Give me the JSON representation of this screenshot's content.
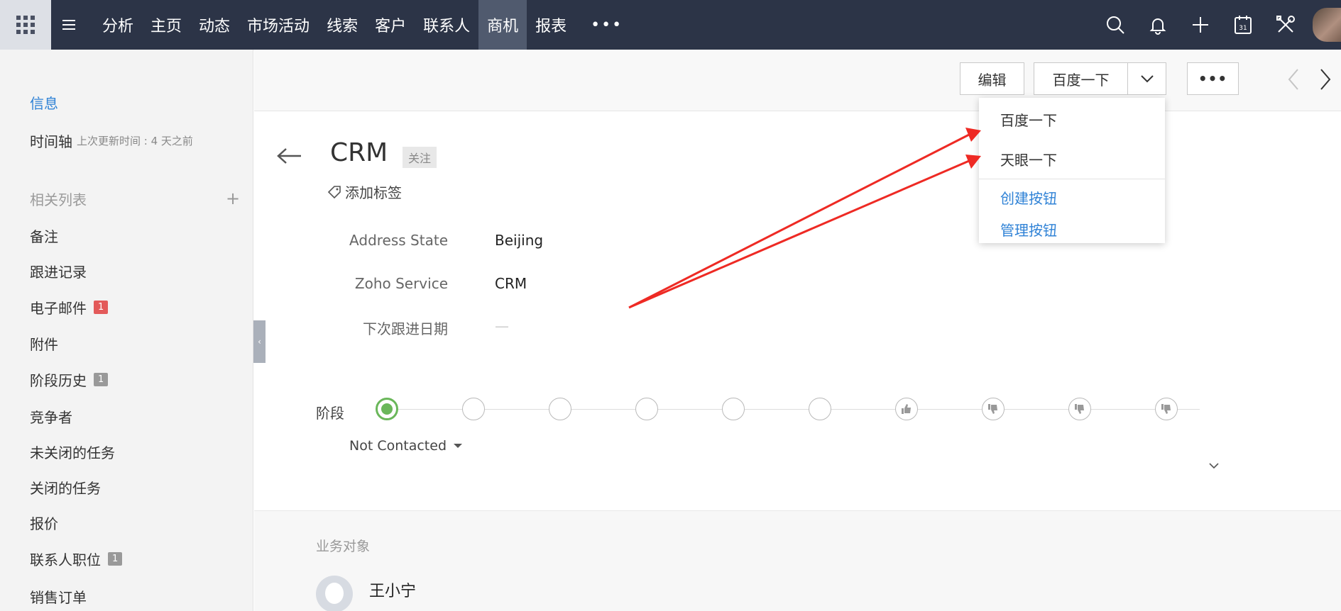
{
  "nav": {
    "items": [
      "分析",
      "主页",
      "动态",
      "市场活动",
      "线索",
      "客户",
      "联系人",
      "商机",
      "报表"
    ],
    "active": "商机",
    "more": "•••"
  },
  "sidebar": {
    "info": "信息",
    "timeline": "时间轴",
    "timeline_sub": "上次更新时间 : 4 天之前",
    "related_header": "相关列表",
    "items": [
      {
        "label": "备注",
        "badge": ""
      },
      {
        "label": "跟进记录",
        "badge": ""
      },
      {
        "label": "电子邮件",
        "badge": "1"
      },
      {
        "label": "附件",
        "badge": ""
      },
      {
        "label": "阶段历史",
        "badge": "1"
      },
      {
        "label": "竞争者",
        "badge": ""
      },
      {
        "label": "未关闭的任务",
        "badge": ""
      },
      {
        "label": "关闭的任务",
        "badge": ""
      },
      {
        "label": "报价",
        "badge": ""
      },
      {
        "label": "联系人职位",
        "badge": "1"
      },
      {
        "label": "销售订单",
        "badge": ""
      }
    ]
  },
  "actions": {
    "edit": "编辑",
    "baidu": "百度一下",
    "more": "•••"
  },
  "dropdown": {
    "items": [
      "百度一下",
      "天眼一下"
    ],
    "create": "创建按钮",
    "manage": "管理按钮"
  },
  "record": {
    "title": "CRM",
    "follow": "关注",
    "add_tag": "添加标签",
    "fields": [
      {
        "label": "Address State",
        "value": "Beijing"
      },
      {
        "label": "Zoho Service",
        "value": "CRM"
      },
      {
        "label": "下次跟进日期",
        "value": "—"
      }
    ],
    "stage_label": "阶段",
    "stage_value": "Not Contacted",
    "business_header": "业务对象",
    "contact_name": "王小宁"
  },
  "colors": {
    "topbar": "#2c3447",
    "accent": "#2f82d6",
    "stage_active": "#6ab75a",
    "annotation": "#ee2a24"
  }
}
